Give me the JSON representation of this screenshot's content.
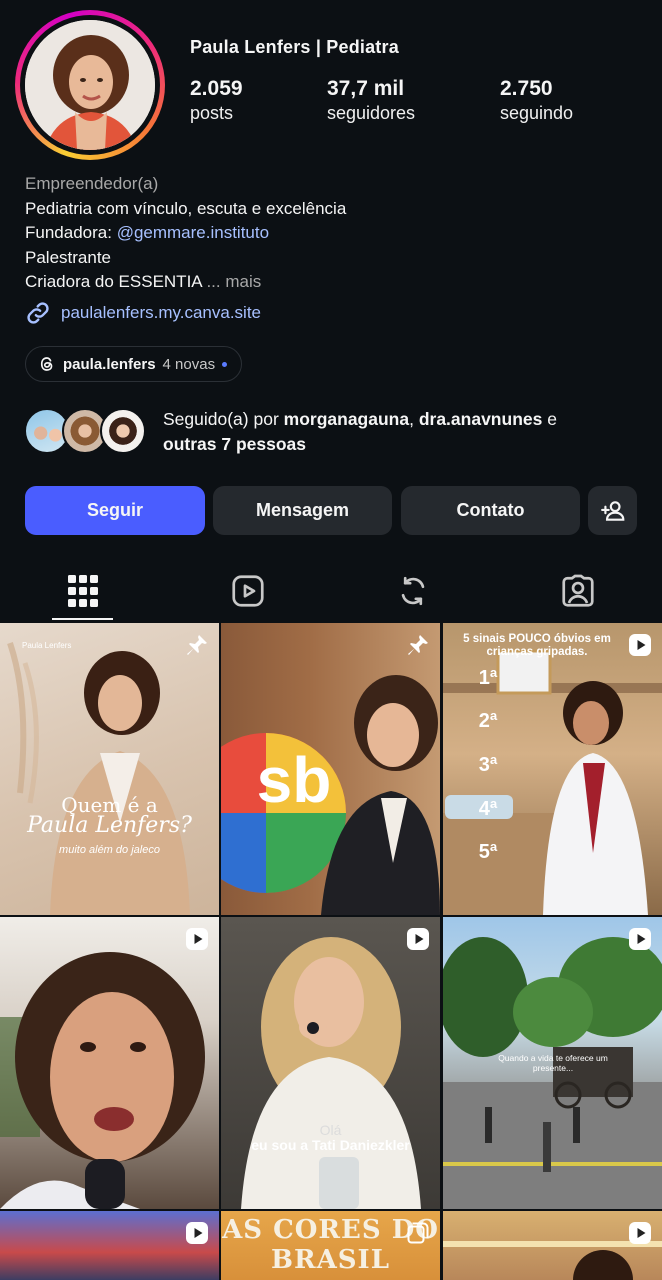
{
  "profile": {
    "name": "Paula Lenfers | Pediatra",
    "stats": [
      {
        "value": "2.059",
        "label": "posts"
      },
      {
        "value": "37,7 mil",
        "label": "seguidores"
      },
      {
        "value": "2.750",
        "label": "seguindo"
      }
    ],
    "category": "Empreendedor(a)",
    "bio_line1": "Pediatria com vínculo, escuta e excelência",
    "bio_founder_prefix": "Fundadora: ",
    "bio_founder_mention": "@gemmare.instituto",
    "bio_line3": "Palestrante",
    "bio_line4": "Criadora do ESSENTIA",
    "bio_more": "... mais",
    "link": "paulalenfers.my.canva.site",
    "threads": {
      "handle": "paula.lenfers",
      "new": "4 novas"
    },
    "followed_by": {
      "prefix": "Seguido(a) por ",
      "user1": "morganagauna",
      "sep": ", ",
      "user2": "dra.anavnunes",
      "and": " e",
      "others": "outras 7 pessoas"
    }
  },
  "actions": {
    "follow": "Seguir",
    "message": "Mensagem",
    "contact": "Contato"
  },
  "tabs": [
    "grid-icon",
    "reels-icon",
    "reposts-icon",
    "tagged-icon"
  ],
  "posts": [
    {
      "brand": "Paula Lenfers",
      "title1": "Quem é a",
      "title2": "Paula Lenfers?",
      "subtitle": "muito além do jaleco",
      "badge": "pin"
    },
    {
      "brand": "sb",
      "badge": "pin"
    },
    {
      "title": "5 sinais POUCO óbvios em crianças gripadas.",
      "ranks": [
        "1ª",
        "2ª",
        "3ª",
        "4ª",
        "5ª"
      ],
      "badge": "reel"
    },
    {
      "badge": "reel"
    },
    {
      "caption1": "Olá",
      "caption2": "eu sou a Tati Daniezkler",
      "badge": "reel"
    },
    {
      "caption": "Quando a vida te oferece um presente...",
      "badge": "reel"
    },
    {
      "badge": "reel"
    },
    {
      "title": "AS CORES DO BRASIL",
      "badge": "carousel"
    },
    {
      "badge": "reel"
    }
  ],
  "colors": {
    "background": "#0c1014",
    "primary_button": "#4a5dff",
    "secondary_button": "#25292e",
    "link": "#a7c0ff"
  }
}
